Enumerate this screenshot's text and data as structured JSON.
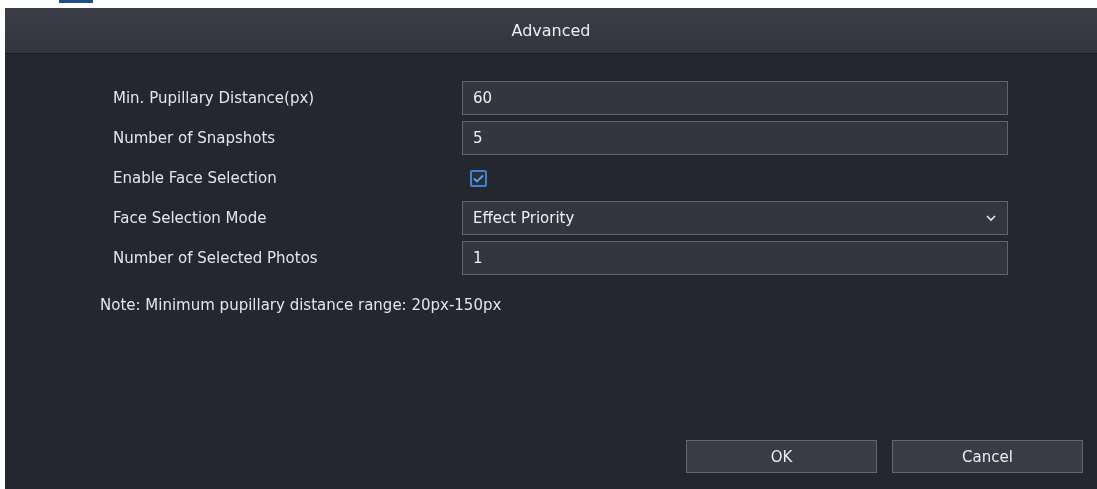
{
  "window": {
    "title": "Advanced"
  },
  "fields": [
    {
      "label": "Min. Pupillary Distance(px)",
      "kind": "text",
      "value": "60"
    },
    {
      "label": "Number of Snapshots",
      "kind": "text",
      "value": "5"
    },
    {
      "label": "Enable Face Selection",
      "kind": "checkbox",
      "checked": true
    },
    {
      "label": "Face Selection Mode",
      "kind": "select",
      "value": "Effect Priority"
    },
    {
      "label": "Number of Selected Photos",
      "kind": "text",
      "value": "1"
    }
  ],
  "note": "Note: Minimum pupillary distance range: 20px-150px",
  "buttons": [
    "OK",
    "Cancel"
  ]
}
